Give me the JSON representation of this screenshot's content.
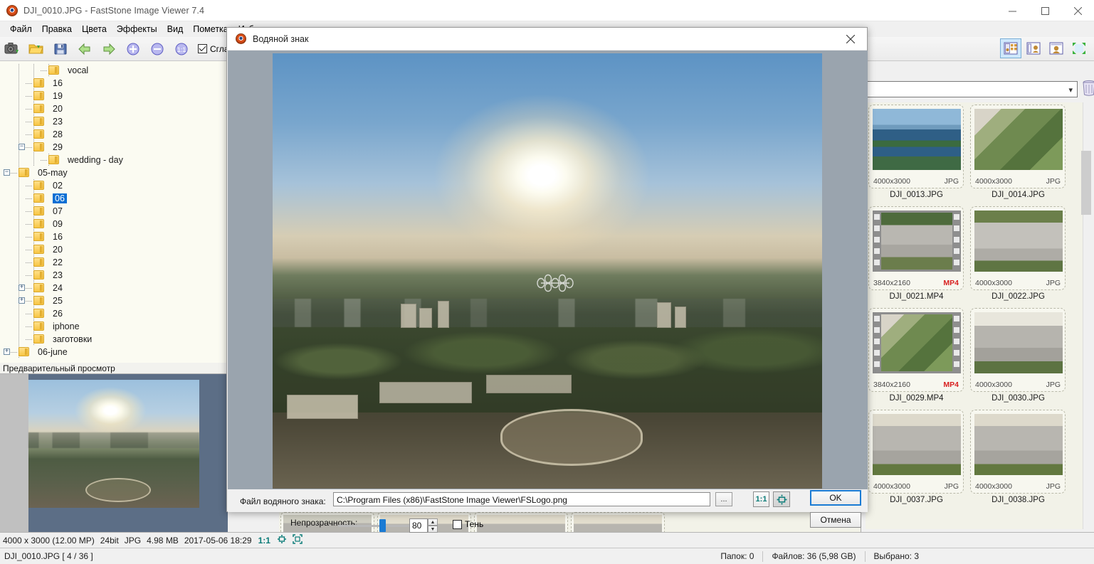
{
  "window": {
    "title": "DJI_0010.JPG  -  FastStone Image Viewer 7.4",
    "app_icon": "faststone-icon",
    "minimize": "minimize-icon",
    "maximize": "maximize-icon",
    "close": "close-icon"
  },
  "menu": [
    {
      "label": "Файл"
    },
    {
      "label": "Правка"
    },
    {
      "label": "Цвета"
    },
    {
      "label": "Эффекты"
    },
    {
      "label": "Вид"
    },
    {
      "label": "Пометка"
    },
    {
      "label": "Избра"
    }
  ],
  "toolbar": {
    "buttons": [
      {
        "name": "camera-capture-icon"
      },
      {
        "name": "open-folder-icon"
      },
      {
        "name": "save-icon"
      },
      {
        "name": "previous-icon"
      },
      {
        "name": "next-icon"
      },
      {
        "name": "zoom-in-icon"
      },
      {
        "name": "zoom-out-icon"
      },
      {
        "name": "actual-size-icon"
      }
    ],
    "smoothing_label": "Сглаж",
    "smoothing_checked": true,
    "view_modes": [
      {
        "name": "view-thumbnails-icon",
        "active": true
      },
      {
        "name": "view-list-icon",
        "active": false
      },
      {
        "name": "view-preview-icon",
        "active": false
      },
      {
        "name": "fullscreen-icon",
        "active": false
      }
    ]
  },
  "tree": {
    "items": [
      {
        "label": "vocal",
        "depth": 4,
        "expander": "",
        "selected": false
      },
      {
        "label": "16",
        "depth": 3,
        "expander": "",
        "selected": false
      },
      {
        "label": "19",
        "depth": 3,
        "expander": "",
        "selected": false
      },
      {
        "label": "20",
        "depth": 3,
        "expander": "",
        "selected": false
      },
      {
        "label": "23",
        "depth": 3,
        "expander": "",
        "selected": false
      },
      {
        "label": "28",
        "depth": 3,
        "expander": "",
        "selected": false
      },
      {
        "label": "29",
        "depth": 3,
        "expander": "minus",
        "selected": false
      },
      {
        "label": "wedding - day",
        "depth": 4,
        "expander": "",
        "selected": false
      },
      {
        "label": "05-may",
        "depth": 2,
        "expander": "minus",
        "selected": false
      },
      {
        "label": "02",
        "depth": 3,
        "expander": "",
        "selected": false
      },
      {
        "label": "06",
        "depth": 3,
        "expander": "",
        "selected": true
      },
      {
        "label": "07",
        "depth": 3,
        "expander": "",
        "selected": false
      },
      {
        "label": "09",
        "depth": 3,
        "expander": "",
        "selected": false
      },
      {
        "label": "16",
        "depth": 3,
        "expander": "",
        "selected": false
      },
      {
        "label": "20",
        "depth": 3,
        "expander": "",
        "selected": false
      },
      {
        "label": "22",
        "depth": 3,
        "expander": "",
        "selected": false
      },
      {
        "label": "23",
        "depth": 3,
        "expander": "",
        "selected": false
      },
      {
        "label": "24",
        "depth": 3,
        "expander": "plus",
        "selected": false
      },
      {
        "label": "25",
        "depth": 3,
        "expander": "plus",
        "selected": false
      },
      {
        "label": "26",
        "depth": 3,
        "expander": "",
        "selected": false
      },
      {
        "label": "iphone",
        "depth": 3,
        "expander": "",
        "selected": false
      },
      {
        "label": "заготовки",
        "depth": 3,
        "expander": "",
        "selected": false
      },
      {
        "label": "06-june",
        "depth": 2,
        "expander": "plus",
        "selected": false
      }
    ]
  },
  "preview": {
    "header": "Предварительный просмотр"
  },
  "status_top": {
    "dimensions": "4000 x 3000 (12.00 MP)",
    "bitdepth": "24bit",
    "format": "JPG",
    "size": "4.98 MB",
    "datetime": "2017-05-06 18:29",
    "zoom": "1:1",
    "fit_icon": "fit-to-window-icon",
    "fullscreen_icon": "fullscreen-icon"
  },
  "status_bottom": {
    "file": "DJI_0010.JPG [ 4 / 36 ]",
    "folders": "Папок: 0",
    "files": "Файлов: 36 (5,98 GB)",
    "selected": "Выбрано: 3"
  },
  "browser": {
    "address_value": "",
    "dropdown_icon": "chevron-down-icon",
    "trash_icon": "trash-icon",
    "thumbnails": [
      {
        "name": "DJI_0013.JPG",
        "dimensions": "4000x3000",
        "format": "JPG",
        "is_video": false,
        "scene": "river"
      },
      {
        "name": "DJI_0014.JPG",
        "dimensions": "4000x3000",
        "format": "JPG",
        "is_video": false,
        "scene": "aerial-roof"
      },
      {
        "name": "DJI_0021.MP4",
        "dimensions": "3840x2160",
        "format": "MP4",
        "is_video": true,
        "scene": "car-white"
      },
      {
        "name": "DJI_0022.JPG",
        "dimensions": "4000x3000",
        "format": "JPG",
        "is_video": false,
        "scene": "car-white2"
      },
      {
        "name": "DJI_0029.MP4",
        "dimensions": "3840x2160",
        "format": "MP4",
        "is_video": true,
        "scene": "aerial-roof"
      },
      {
        "name": "DJI_0030.JPG",
        "dimensions": "4000x3000",
        "format": "JPG",
        "is_video": false,
        "scene": "car-dark"
      },
      {
        "name": "DJI_0037.JPG",
        "dimensions": "4000x3000",
        "format": "JPG",
        "is_video": false,
        "scene": "car-white3"
      },
      {
        "name": "DJI_0038.JPG",
        "dimensions": "4000x3000",
        "format": "JPG",
        "is_video": false,
        "scene": "car-white4"
      }
    ]
  },
  "filmstrip": {
    "items": [
      {
        "scene": "road-a"
      },
      {
        "scene": "road-b"
      },
      {
        "scene": "road-c"
      },
      {
        "scene": "road-d"
      }
    ]
  },
  "dialog": {
    "title": "Водяной знак",
    "icon": "faststone-icon",
    "close": "close-icon",
    "file_label": "Файл водяного знака:",
    "file_value": "C:\\Program Files (x86)\\FastStone Image Viewer\\FSLogo.png",
    "browse_label": "...",
    "zoom_1_1_label": "1:1",
    "fit_icon": "fit-to-window-icon",
    "ok_label": "OK",
    "cancel_label": "Отмена",
    "opacity_label": "Непрозрачность:",
    "opacity_value": "80",
    "shadow_label": "Тень",
    "shadow_checked": false,
    "watermark_icon": "fslogo-watermark"
  },
  "colors": {
    "accent": "#1a7bd4",
    "selection": "#0b6fd4",
    "folder": "#f7c544",
    "zoom_text": "#0b7c78",
    "mp4_badge": "#d81f1f",
    "tree_bg": "#fbfbf2"
  }
}
